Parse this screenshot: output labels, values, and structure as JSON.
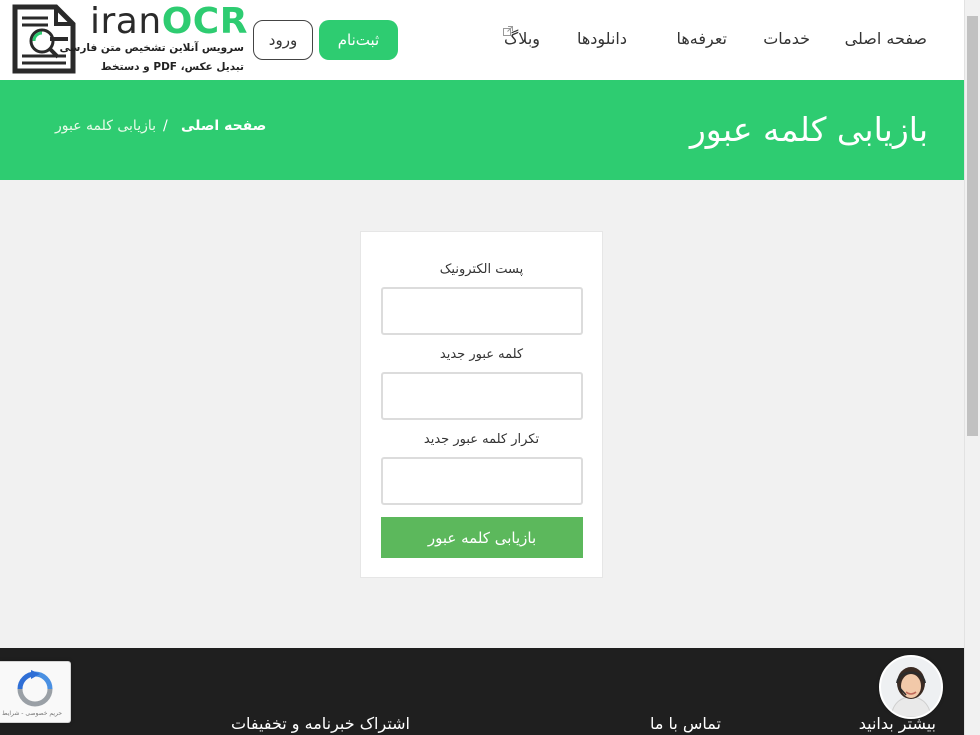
{
  "header": {
    "logo": {
      "word_part1": "iran",
      "word_part2": "OCR",
      "tagline1": "سرویس آنلاین تشخیص متن فارسی",
      "tagline2": "تبدیل عکس، PDF و دستخط"
    },
    "login_label": "ورود",
    "signup_label": "ثبت‌نام",
    "nav": [
      "صفحه اصلی",
      "خدمات",
      "تعرفه‌ها",
      "دانلودها",
      "وبلاگ"
    ],
    "external_link_icon": "external-link-icon"
  },
  "banner": {
    "title": "بازیابی کلمه عبور",
    "breadcrumb": {
      "home": "صفحه اصلی",
      "separator": "/",
      "current": "بازیابی کلمه عبور"
    }
  },
  "form": {
    "email_label": "پست الکترونیک",
    "email_value": "",
    "new_password_label": "کلمه عبور جدید",
    "new_password_value": "",
    "repeat_password_label": "تکرار کلمه عبور جدید",
    "repeat_password_value": "",
    "submit_label": "بازیابی کلمه عبور"
  },
  "footer": {
    "col_learn": "بیشتر بدانید",
    "col_contact": "تماس با ما",
    "col_newsletter": "اشتراک خبرنامه و تخفیفات"
  },
  "recaptcha": {
    "text": "حریم خصوصی - شرایط"
  },
  "colors": {
    "brand_green": "#2ecc71",
    "submit_green": "#5cb85c",
    "footer_bg": "#1f1f1f",
    "page_bg": "#f1f1f1"
  }
}
